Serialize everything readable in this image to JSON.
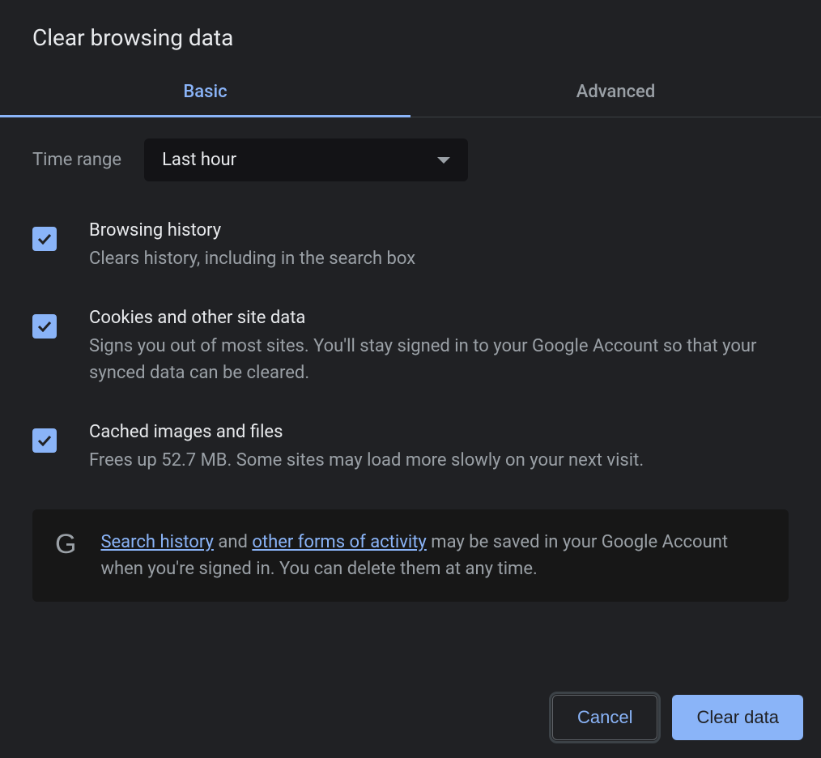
{
  "dialog": {
    "title": "Clear browsing data",
    "tabs": {
      "basic": "Basic",
      "advanced": "Advanced"
    },
    "time_range": {
      "label": "Time range",
      "value": "Last hour"
    },
    "options": [
      {
        "title": "Browsing history",
        "desc": "Clears history, including in the search box",
        "checked": true
      },
      {
        "title": "Cookies and other site data",
        "desc": "Signs you out of most sites. You'll stay signed in to your Google Account so that your synced data can be cleared.",
        "checked": true
      },
      {
        "title": "Cached images and files",
        "desc": "Frees up 52.7 MB. Some sites may load more slowly on your next visit.",
        "checked": true
      }
    ],
    "info": {
      "link1": "Search history",
      "mid1": " and ",
      "link2": "other forms of activity",
      "rest": " may be saved in your Google Account when you're signed in. You can delete them at any time."
    },
    "buttons": {
      "cancel": "Cancel",
      "clear": "Clear data"
    }
  }
}
